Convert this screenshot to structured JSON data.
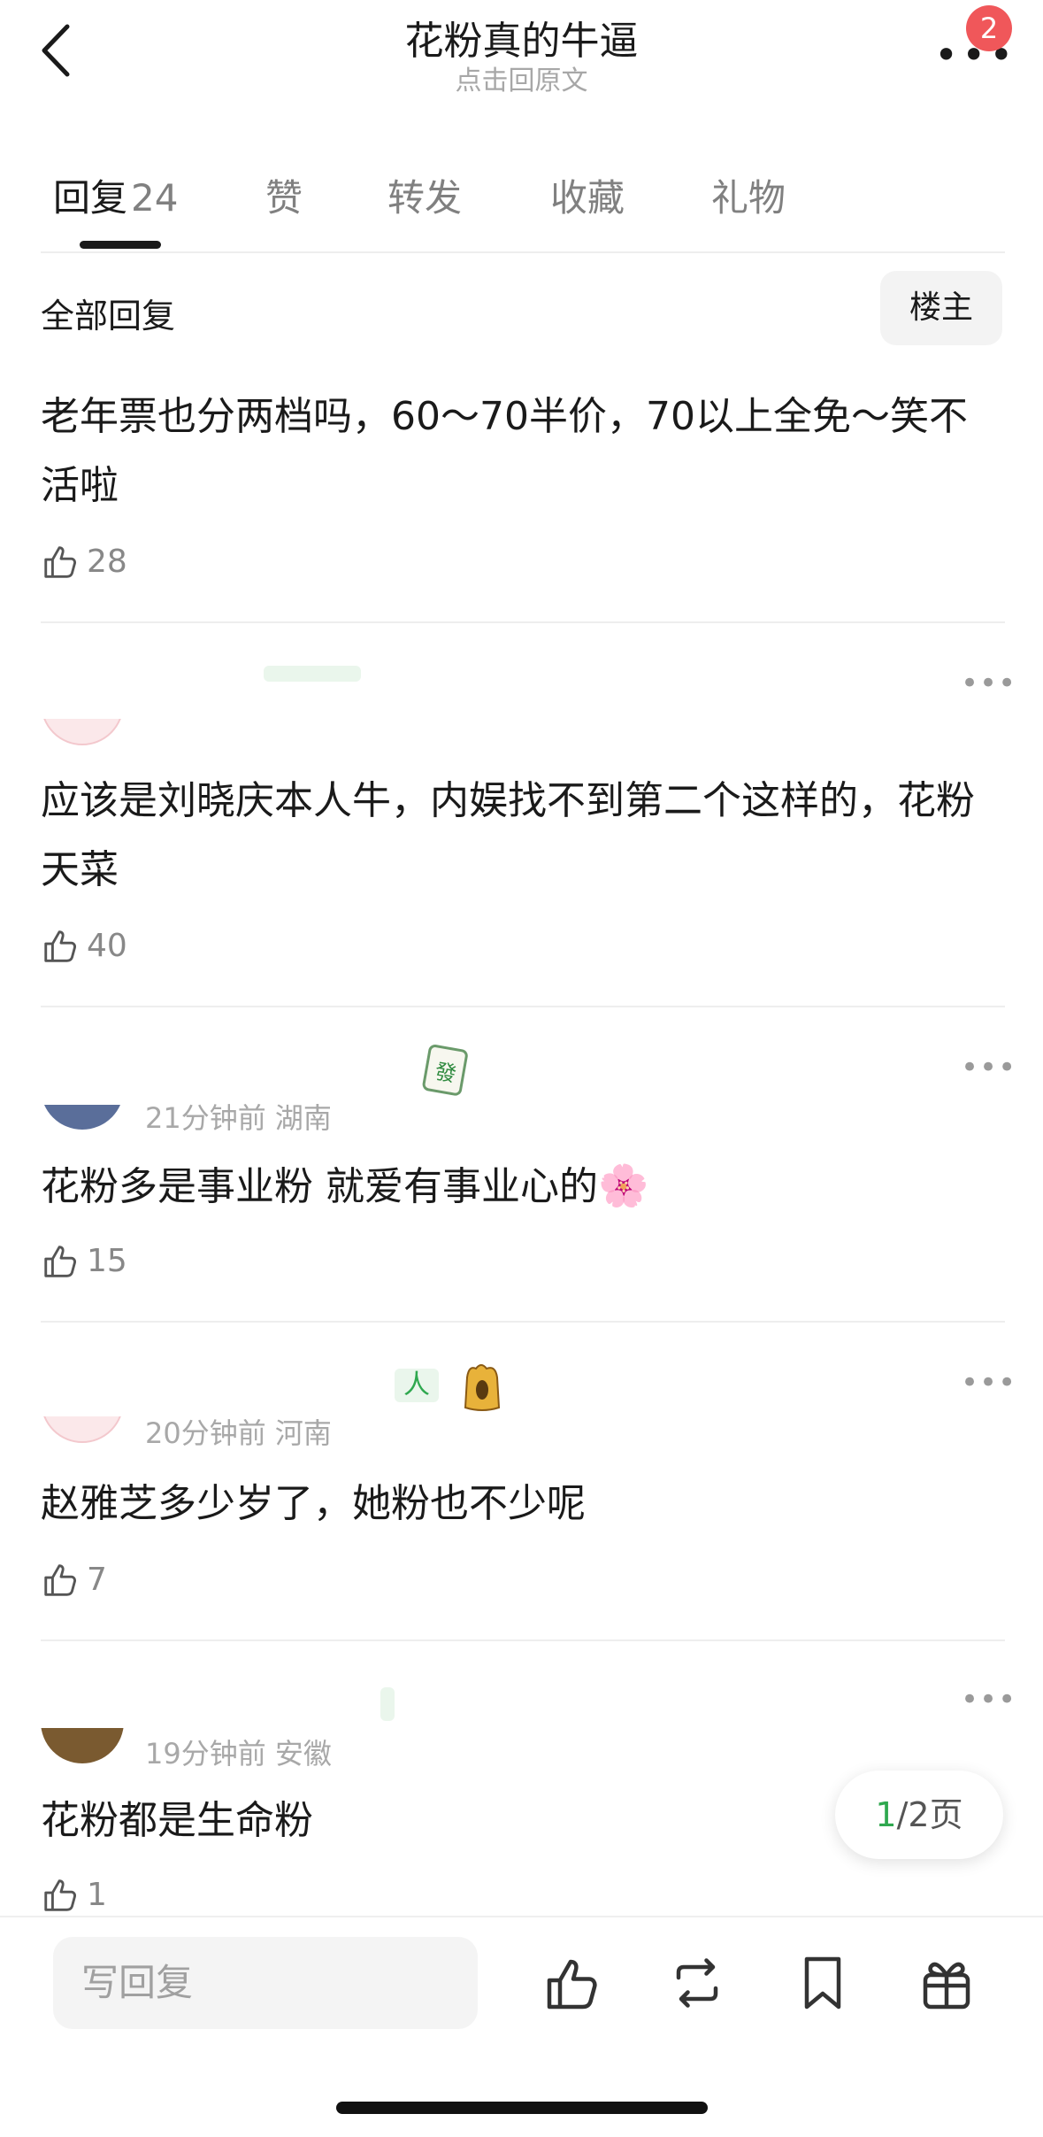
{
  "header": {
    "title": "花粉真的牛逼",
    "subtitle": "点击回原文",
    "notification_count": "2"
  },
  "tabs": [
    {
      "label": "回复",
      "count": "24",
      "active": true
    },
    {
      "label": "赞",
      "active": false
    },
    {
      "label": "转发",
      "active": false
    },
    {
      "label": "收藏",
      "active": false
    },
    {
      "label": "礼物",
      "active": false
    }
  ],
  "filter": {
    "all_replies_label": "全部回复",
    "owner_button_label": "楼主"
  },
  "comments": [
    {
      "text": "老年票也分两档吗，60～70半价，70以上全免～笑不活啦",
      "likes": "28"
    },
    {
      "text": "应该是刘晓庆本人牛，内娱找不到第二个这样的，花粉天菜",
      "likes": "40"
    },
    {
      "meta": "21分钟前 湖南",
      "badge_icon": "mahjong-fa-tile-icon",
      "text": "花粉多是事业粉 就爱有事业心的",
      "trailing_icon": "cherry-blossom-emoji",
      "likes": "15"
    },
    {
      "meta": "20分钟前 河南",
      "badge_text": "人",
      "text": "赵雅芝多少岁了，她粉也不少呢",
      "likes": "7"
    },
    {
      "meta": "19分钟前 安徽",
      "text": "花粉都是生命粉",
      "likes": "1"
    }
  ],
  "pagination": {
    "current": "1",
    "total": "/2页"
  },
  "bottom_bar": {
    "reply_placeholder": "写回复",
    "icons": [
      "like-icon",
      "repost-icon",
      "bookmark-icon",
      "gift-icon"
    ]
  },
  "colors": {
    "accent_green": "#2fa84f",
    "badge_red": "#f0575a",
    "text_primary": "#1a1a1a",
    "text_secondary": "#a8a8a8"
  }
}
